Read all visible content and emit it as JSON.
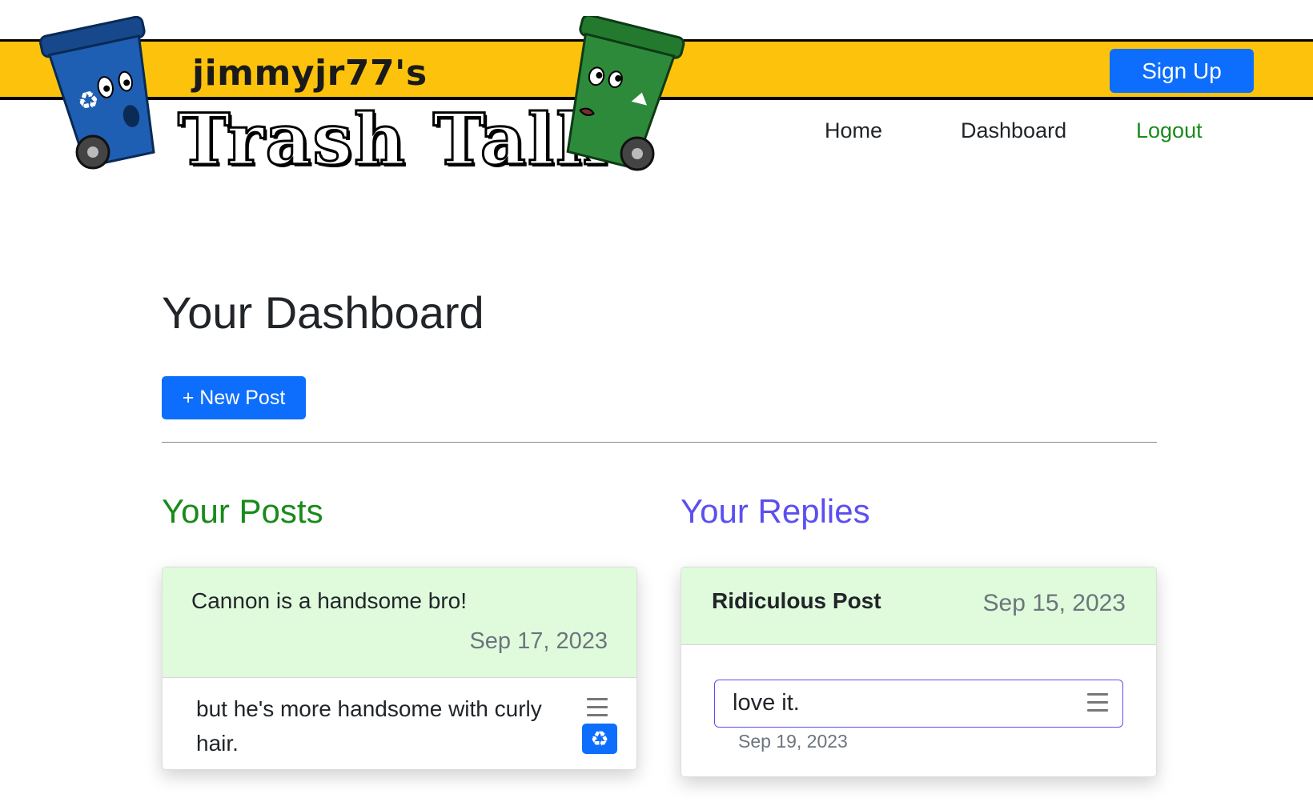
{
  "header": {
    "username": "jimmyjr77's",
    "logo_text": "Trash Talk",
    "signup_label": "Sign Up",
    "nav": {
      "home": "Home",
      "dashboard": "Dashboard",
      "logout": "Logout"
    },
    "colors": {
      "band": "#fdc30c",
      "blue_bin": "#1f5fb3",
      "green_bin": "#2e8a3b"
    }
  },
  "main": {
    "page_title": "Your Dashboard",
    "new_post_label": "+ New Post",
    "posts_title": "Your Posts",
    "replies_title": "Your Replies",
    "posts": [
      {
        "title": "Cannon is a handsome bro!",
        "date": "Sep 17, 2023",
        "body": "but he's more handsome with curly hair."
      }
    ],
    "replies": [
      {
        "post_title": "Ridiculous Post",
        "post_date": "Sep 15, 2023",
        "text": "love it.",
        "date": "Sep 19, 2023"
      }
    ]
  },
  "icons": {
    "menu": "hamburger-icon",
    "recycle": "recycle-icon"
  },
  "colors": {
    "primary": "#0d6efd",
    "posts_green": "#198a1a",
    "replies_purple": "#5b4ff0",
    "card_header": "#dffbdc"
  }
}
